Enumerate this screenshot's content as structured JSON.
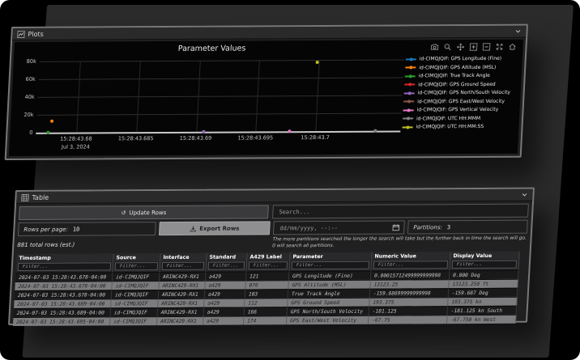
{
  "plots_panel": {
    "title": "Plots",
    "modebar_icons": [
      "camera",
      "zoom",
      "pan",
      "zoom-in",
      "zoom-out",
      "autoscale",
      "reset-axes"
    ]
  },
  "chart_data": {
    "type": "scatter",
    "title": "Parameter Values",
    "xlabel": "",
    "ylabel": "",
    "x_date_subtitle": "Jul 3, 2024",
    "grid": true,
    "legend_position": "right",
    "ylim": [
      0,
      85000
    ],
    "y_ticks": [
      {
        "label": "80k",
        "pct": 0
      },
      {
        "label": "60k",
        "pct": 25
      },
      {
        "label": "40k",
        "pct": 50
      },
      {
        "label": "20k",
        "pct": 75
      },
      {
        "label": "0",
        "pct": 100
      }
    ],
    "x_ticks": [
      {
        "label": "15:28:43.68",
        "sub": "Jul 3, 2024",
        "pct": 11.1
      },
      {
        "label": "15:28:43.685",
        "sub": "",
        "pct": 27.5
      },
      {
        "label": "15:28:43.69",
        "sub": "",
        "pct": 43.9
      },
      {
        "label": "15:28:43.695",
        "sub": "",
        "pct": 60.3
      },
      {
        "label": "15:28:43.7",
        "sub": "",
        "pct": 76.7
      }
    ],
    "series": [
      {
        "name": "id-CIMQJQIF: GPS Longitude (Fine)",
        "color": "#1f77b4",
        "points": [
          {
            "t": "15:28:43.678",
            "v": 0.00015712499999999998
          }
        ]
      },
      {
        "name": "id-CIMQJQIF: GPS Altitude (MSL)",
        "color": "#ff7f0e",
        "points": [
          {
            "t": "15:28:43.678",
            "v": 13123.25
          }
        ]
      },
      {
        "name": "id-CIMQJQIF: True Track Angle",
        "color": "#2ca02c",
        "points": [
          {
            "t": "15:28:43.678",
            "v": -159.68699999999998
          }
        ]
      },
      {
        "name": "id-CIMQJQIF: GPS Ground Speed",
        "color": "#d62728",
        "points": [
          {
            "t": "15:28:43.689",
            "v": 193.375
          }
        ]
      },
      {
        "name": "id-CIMQJQIF: GPS North/South Velocity",
        "color": "#9467bd",
        "points": [
          {
            "t": "15:28:43.689",
            "v": -181.125
          }
        ]
      },
      {
        "name": "id-CIMQJQIF: GPS East/West Velocity",
        "color": "#8c564b",
        "points": [
          {
            "t": "15:28:43.695",
            "v": -67.75
          }
        ]
      },
      {
        "name": "id-CIMQJQIF: GPS Vertical Velocity",
        "color": "#e377c2",
        "points": []
      },
      {
        "name": "id-CIMQJQIF: UTC HH:MMM",
        "color": "#7f7f7f",
        "points": []
      },
      {
        "name": "id-CIMQJQIF: UTC HH:MM:SS",
        "color": "#bcbd22",
        "points": []
      }
    ],
    "render_dots": [
      {
        "pct_x": 4.2,
        "pct_y": 84.5,
        "color": "#ff7f0e"
      },
      {
        "pct_x": 3.4,
        "pct_y": 100,
        "color": "#2ca02c"
      },
      {
        "pct_x": 46.0,
        "pct_y": 100,
        "color": "#9467bd"
      },
      {
        "pct_x": 69.5,
        "pct_y": 100,
        "color": "#e377c2"
      },
      {
        "pct_x": 76.3,
        "pct_y": 3,
        "color": "#bcbd22"
      },
      {
        "pct_x": 93.0,
        "pct_y": 100,
        "color": "#7f7f7f"
      }
    ]
  },
  "table_panel": {
    "title": "Table",
    "update_rows_label": "Update Rows",
    "search_placeholder": "Search...",
    "rows_per_page_label": "Rows per page:",
    "rows_per_page_value": "10",
    "export_rows_label": "Export Rows",
    "datetime_placeholder": "dd/mm/yyyy, --:--",
    "partitions_label": "Partitions:",
    "partitions_value": "3",
    "total_rows_text": "881 total rows (est.)",
    "partitions_note": "The more partitions searched the longer the search will take but the further back in time the search will go. 0 will search all partitions.",
    "filter_placeholder": "Filter...",
    "columns": [
      "Timestamp",
      "Source",
      "Interface",
      "Standard",
      "A429 Label",
      "Parameter",
      "Numeric Value",
      "Display Value"
    ],
    "rows": [
      [
        "2024-07-03 15:28:43.678-04:00",
        "id-CIMQJQIF",
        "ARINC429-RX1",
        "a429",
        "121",
        "GPS Longitude (Fine)",
        "0.00015712499999999998",
        "0.000 Deg"
      ],
      [
        "2024-07-03 15:28:43.678-04:00",
        "id-CIMQJQIF",
        "ARINC429-RX1",
        "a429",
        "076",
        "GPS Altitude (MSL)",
        "13123.25",
        "13123.250 ft"
      ],
      [
        "2024-07-03 15:28:43.678-04:00",
        "id-CIMQJQIF",
        "ARINC429-RX1",
        "a429",
        "103",
        "True Track Angle",
        "-159.68699999999998",
        "-159.687 Deg"
      ],
      [
        "2024-07-03 15:28:43.689-04:00",
        "id-CIMQJQIF",
        "ARINC429-RX1",
        "a429",
        "112",
        "GPS Ground Speed",
        "193.375",
        "193.375 kn"
      ],
      [
        "2024-07-03 15:28:43.689-04:00",
        "id-CIMQJQIF",
        "ARINC429-RX1",
        "a429",
        "166",
        "GPS North/South Velocity",
        "-181.125",
        "-181.125 kn South"
      ],
      [
        "2024-07-03 15:28:43.695-04:00",
        "id-CIMQJQIF",
        "ARINC429-RX1",
        "a429",
        "174",
        "GPS East/West Velocity",
        "-67.75",
        "-67.750 kn West"
      ]
    ]
  }
}
